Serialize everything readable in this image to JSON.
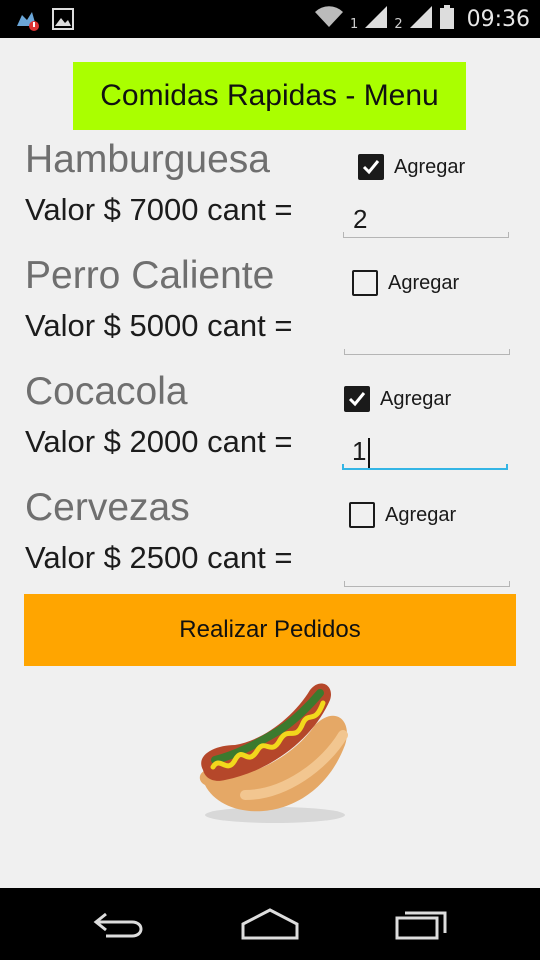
{
  "status_bar": {
    "sim1_label": "1",
    "sim2_label": "2",
    "time": "09:36",
    "icons": [
      "notification-app-icon",
      "image-icon",
      "wifi-icon",
      "signal-icon",
      "signal-icon",
      "battery-icon"
    ]
  },
  "title": "Comidas Rapidas - Menu",
  "items": [
    {
      "name": "Hamburguesa",
      "price_label": "Valor $ 7000 cant =",
      "checkbox_label": "Agregar",
      "checked": true,
      "qty": "2"
    },
    {
      "name": "Perro Caliente",
      "price_label": "Valor $ 5000 cant =",
      "checkbox_label": "Agregar",
      "checked": false,
      "qty": ""
    },
    {
      "name": "Cocacola",
      "price_label": "Valor $ 2000 cant =",
      "checkbox_label": "Agregar",
      "checked": true,
      "qty": "1"
    },
    {
      "name": "Cervezas",
      "price_label": "Valor $ 2500 cant =",
      "checkbox_label": "Agregar",
      "checked": false,
      "qty": ""
    }
  ],
  "order_button": "Realizar Pedidos",
  "image": "hotdog-image",
  "nav": [
    "back-icon",
    "home-icon",
    "recent-apps-icon"
  ],
  "colors": {
    "title_bg": "#aaff00",
    "button_bg": "#ffa500",
    "focus": "#33b5e5"
  }
}
